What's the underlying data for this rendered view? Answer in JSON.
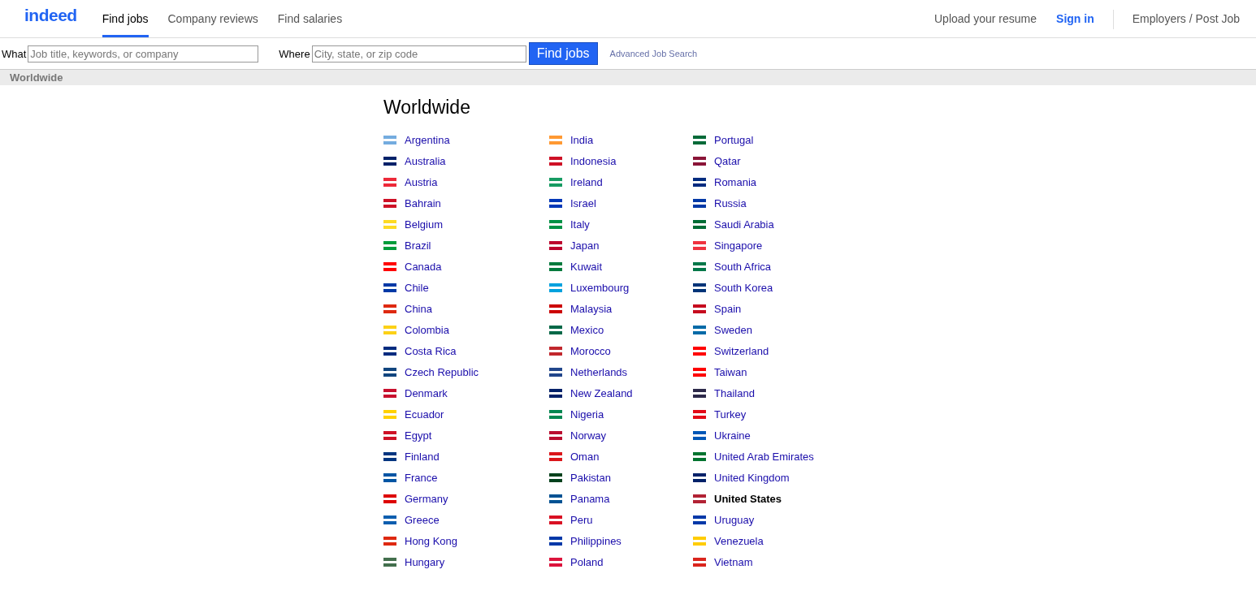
{
  "header": {
    "logo": "indeed",
    "nav": [
      {
        "label": "Find jobs",
        "selected": true
      },
      {
        "label": "Company reviews",
        "selected": false
      },
      {
        "label": "Find salaries",
        "selected": false
      }
    ],
    "right": [
      {
        "label": "Upload your resume",
        "kind": "plain"
      },
      {
        "label": "Sign in",
        "kind": "strong"
      },
      {
        "label": "Employers / Post Job",
        "kind": "plain"
      }
    ]
  },
  "search": {
    "what_label": "What",
    "what_placeholder": "Job title, keywords, or company",
    "where_label": "Where",
    "where_placeholder": "City, state, or zip code",
    "button": "Find jobs",
    "advanced": "Advanced Job Search"
  },
  "breadcrumb": "Worldwide",
  "heading": "Worldwide",
  "columns": [
    [
      {
        "name": "Argentina",
        "color": "#74acdf",
        "selected": false
      },
      {
        "name": "Australia",
        "color": "#012169",
        "selected": false
      },
      {
        "name": "Austria",
        "color": "#ed2939",
        "selected": false
      },
      {
        "name": "Bahrain",
        "color": "#ce1126",
        "selected": false
      },
      {
        "name": "Belgium",
        "color": "#fdda24",
        "selected": false
      },
      {
        "name": "Brazil",
        "color": "#009c3b",
        "selected": false
      },
      {
        "name": "Canada",
        "color": "#ff0000",
        "selected": false
      },
      {
        "name": "Chile",
        "color": "#0039a6",
        "selected": false
      },
      {
        "name": "China",
        "color": "#de2910",
        "selected": false
      },
      {
        "name": "Colombia",
        "color": "#fcd116",
        "selected": false
      },
      {
        "name": "Costa Rica",
        "color": "#002b7f",
        "selected": false
      },
      {
        "name": "Czech Republic",
        "color": "#11457e",
        "selected": false
      },
      {
        "name": "Denmark",
        "color": "#c8102e",
        "selected": false
      },
      {
        "name": "Ecuador",
        "color": "#ffd100",
        "selected": false
      },
      {
        "name": "Egypt",
        "color": "#ce1126",
        "selected": false
      },
      {
        "name": "Finland",
        "color": "#003580",
        "selected": false
      },
      {
        "name": "France",
        "color": "#0055a4",
        "selected": false
      },
      {
        "name": "Germany",
        "color": "#dd0000",
        "selected": false
      },
      {
        "name": "Greece",
        "color": "#0d5eaf",
        "selected": false
      },
      {
        "name": "Hong Kong",
        "color": "#de2910",
        "selected": false
      },
      {
        "name": "Hungary",
        "color": "#436f4d",
        "selected": false
      }
    ],
    [
      {
        "name": "India",
        "color": "#ff9933",
        "selected": false
      },
      {
        "name": "Indonesia",
        "color": "#ce1126",
        "selected": false
      },
      {
        "name": "Ireland",
        "color": "#169b62",
        "selected": false
      },
      {
        "name": "Israel",
        "color": "#0038b8",
        "selected": false
      },
      {
        "name": "Italy",
        "color": "#009246",
        "selected": false
      },
      {
        "name": "Japan",
        "color": "#bc002d",
        "selected": false
      },
      {
        "name": "Kuwait",
        "color": "#007a3d",
        "selected": false
      },
      {
        "name": "Luxembourg",
        "color": "#00a1de",
        "selected": false
      },
      {
        "name": "Malaysia",
        "color": "#cc0001",
        "selected": false
      },
      {
        "name": "Mexico",
        "color": "#006847",
        "selected": false
      },
      {
        "name": "Morocco",
        "color": "#c1272d",
        "selected": false
      },
      {
        "name": "Netherlands",
        "color": "#21468b",
        "selected": false
      },
      {
        "name": "New Zealand",
        "color": "#012169",
        "selected": false
      },
      {
        "name": "Nigeria",
        "color": "#008751",
        "selected": false
      },
      {
        "name": "Norway",
        "color": "#ba0c2f",
        "selected": false
      },
      {
        "name": "Oman",
        "color": "#db161b",
        "selected": false
      },
      {
        "name": "Pakistan",
        "color": "#01411c",
        "selected": false
      },
      {
        "name": "Panama",
        "color": "#005293",
        "selected": false
      },
      {
        "name": "Peru",
        "color": "#d91023",
        "selected": false
      },
      {
        "name": "Philippines",
        "color": "#0038a8",
        "selected": false
      },
      {
        "name": "Poland",
        "color": "#dc143c",
        "selected": false
      }
    ],
    [
      {
        "name": "Portugal",
        "color": "#046a38",
        "selected": false
      },
      {
        "name": "Qatar",
        "color": "#8a1538",
        "selected": false
      },
      {
        "name": "Romania",
        "color": "#002b7f",
        "selected": false
      },
      {
        "name": "Russia",
        "color": "#0039a6",
        "selected": false
      },
      {
        "name": "Saudi Arabia",
        "color": "#006c35",
        "selected": false
      },
      {
        "name": "Singapore",
        "color": "#ef3340",
        "selected": false
      },
      {
        "name": "South Africa",
        "color": "#007749",
        "selected": false
      },
      {
        "name": "South Korea",
        "color": "#003478",
        "selected": false
      },
      {
        "name": "Spain",
        "color": "#c60b1e",
        "selected": false
      },
      {
        "name": "Sweden",
        "color": "#006aa7",
        "selected": false
      },
      {
        "name": "Switzerland",
        "color": "#ff0000",
        "selected": false
      },
      {
        "name": "Taiwan",
        "color": "#fe0000",
        "selected": false
      },
      {
        "name": "Thailand",
        "color": "#2d2a4a",
        "selected": false
      },
      {
        "name": "Turkey",
        "color": "#e30a17",
        "selected": false
      },
      {
        "name": "Ukraine",
        "color": "#0057b7",
        "selected": false
      },
      {
        "name": "United Arab Emirates",
        "color": "#00732f",
        "selected": false
      },
      {
        "name": "United Kingdom",
        "color": "#012169",
        "selected": false
      },
      {
        "name": "United States",
        "color": "#b22234",
        "selected": true
      },
      {
        "name": "Uruguay",
        "color": "#0038a8",
        "selected": false
      },
      {
        "name": "Venezuela",
        "color": "#ffcc00",
        "selected": false
      },
      {
        "name": "Vietnam",
        "color": "#da251d",
        "selected": false
      }
    ]
  ]
}
